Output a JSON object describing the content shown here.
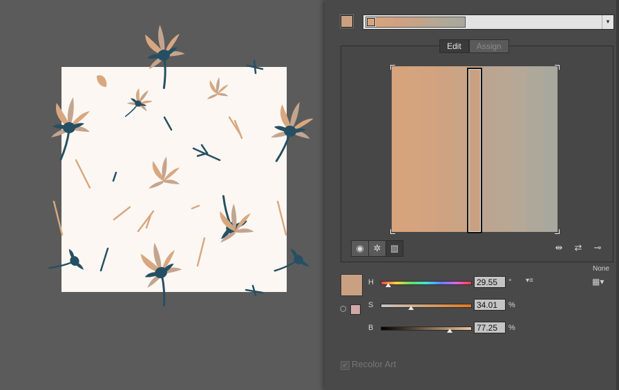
{
  "canvas": {
    "artboard_color": "#fcf7f2",
    "canvas_color": "#5b5b5b",
    "motif_colors": {
      "navy": "#264f63",
      "peach": "#d9a77f",
      "taupe": "#c3a58f"
    }
  },
  "panel": {
    "current_color": "#c9a182",
    "color_group": {
      "preview_colors": [
        "#d6a37d",
        "#d3a27e",
        "#cea181",
        "#c9a384",
        "#c4a386",
        "#bea58c",
        "#b8a792",
        "#b2a896",
        "#aca99b",
        "#a8a89d"
      ]
    },
    "tabs": {
      "edit": "Edit",
      "assign": "Assign"
    },
    "harmony_bars": [
      "#d6a37c",
      "#d4a47f",
      "#d3a37f",
      "#cfa281",
      "#cba485",
      "#c9a182",
      "#bba591",
      "#b9a693",
      "#b4a897",
      "#aea89a",
      "#a9a89e"
    ],
    "selected_bar_index": 5,
    "view_icons": [
      "smooth-color-wheel-icon",
      "segmented-color-wheel-icon",
      "color-bars-icon"
    ],
    "tool_icons": [
      "randomly-change-order-icon",
      "randomly-change-saturation-icon",
      "link-harmony-icon"
    ],
    "none_label": "None",
    "hsb": {
      "h": {
        "label": "H",
        "value": "29.55",
        "unit": "°",
        "position": 0.082
      },
      "s": {
        "label": "S",
        "value": "34.01",
        "unit": "%",
        "position": 0.3401
      },
      "b": {
        "label": "B",
        "value": "77.25",
        "unit": "%",
        "position": 0.7725
      }
    },
    "warning_swatch_color": "#d3a7a8",
    "recolor_art_label": "Recolor Art",
    "recolor_art_checked": true
  }
}
